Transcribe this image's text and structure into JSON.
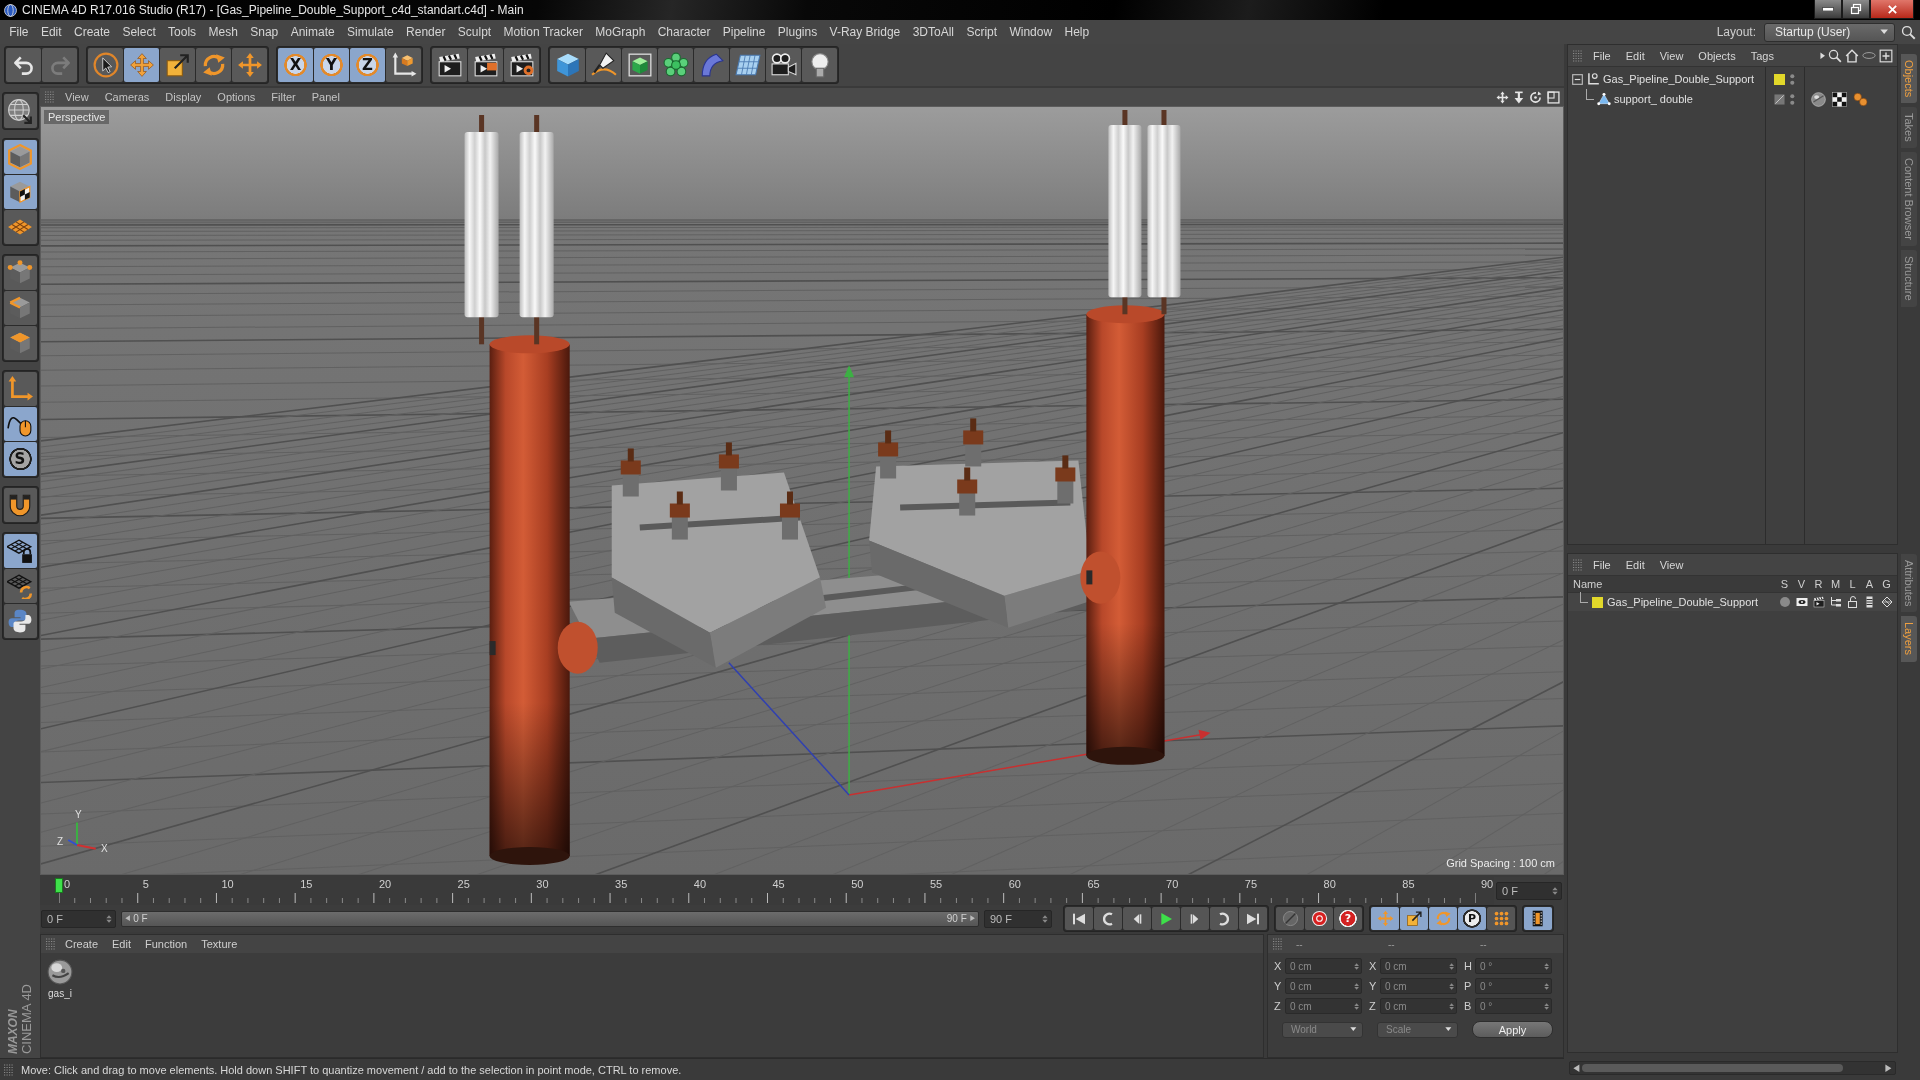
{
  "title_bar": {
    "title": "CINEMA 4D R17.016 Studio (R17) - [Gas_Pipeline_Double_Support_c4d_standart.c4d] - Main"
  },
  "menu_bar": {
    "items": [
      "File",
      "Edit",
      "Create",
      "Select",
      "Tools",
      "Mesh",
      "Snap",
      "Animate",
      "Simulate",
      "Render",
      "Sculpt",
      "Motion Tracker",
      "MoGraph",
      "Character",
      "Pipeline",
      "Plugins",
      "V-Ray Bridge",
      "3DToAll",
      "Script",
      "Window",
      "Help"
    ],
    "layout_label": "Layout:",
    "layout_value": "Startup (User)"
  },
  "toolbar": {
    "groups": [
      [
        {
          "kind": "undo",
          "selected": false,
          "disabled": false
        },
        {
          "kind": "redo",
          "selected": false,
          "disabled": true
        }
      ],
      [
        {
          "kind": "select",
          "selected": false
        },
        {
          "kind": "move",
          "selected": true
        },
        {
          "kind": "scale",
          "selected": false
        },
        {
          "kind": "rotate",
          "selected": false
        },
        {
          "kind": "transform",
          "selected": false
        }
      ],
      [
        {
          "kind": "axis",
          "label": "X",
          "selected": true
        },
        {
          "kind": "axis",
          "label": "Y",
          "selected": true
        },
        {
          "kind": "axis",
          "label": "Z",
          "selected": true
        },
        {
          "kind": "coords",
          "selected": false
        }
      ],
      [
        {
          "kind": "render_view",
          "selected": false
        },
        {
          "kind": "render_pv",
          "selected": false
        },
        {
          "kind": "render_settings",
          "selected": false
        }
      ],
      [
        {
          "kind": "cube",
          "selected": false
        },
        {
          "kind": "pen",
          "selected": false
        },
        {
          "kind": "subdiv",
          "selected": false
        },
        {
          "kind": "cloner",
          "selected": false
        },
        {
          "kind": "deformer",
          "selected": false
        },
        {
          "kind": "floor",
          "selected": false
        },
        {
          "kind": "camera",
          "selected": false
        },
        {
          "kind": "light",
          "selected": false
        }
      ]
    ]
  },
  "left_toolbar": {
    "groups": [
      [
        {
          "kind": "make_editable",
          "selected": false
        }
      ],
      [
        {
          "kind": "model",
          "selected": true
        },
        {
          "kind": "texture",
          "selected": true
        },
        {
          "kind": "workplane",
          "selected": false
        }
      ],
      [
        {
          "kind": "points",
          "selected": false
        },
        {
          "kind": "edges",
          "selected": false
        },
        {
          "kind": "polygons",
          "selected": false
        }
      ],
      [
        {
          "kind": "axis_mode",
          "selected": false
        },
        {
          "kind": "tweak",
          "selected": true
        },
        {
          "kind": "snap",
          "label": "S",
          "selected": true
        }
      ],
      [
        {
          "kind": "magnet",
          "selected": false
        }
      ],
      [
        {
          "kind": "lock_grid",
          "selected": true
        },
        {
          "kind": "grid_rotate",
          "selected": false
        },
        {
          "kind": "python",
          "selected": false
        }
      ]
    ],
    "logo": {
      "brand": "MAXON",
      "product": "CINEMA 4D"
    }
  },
  "viewport": {
    "menu": [
      "View",
      "Cameras",
      "Display",
      "Options",
      "Filter",
      "Panel"
    ],
    "camera": "Perspective",
    "grid_spacing": "Grid Spacing : 100 cm",
    "gizmo": {
      "y": "Y",
      "z": "Z",
      "x": "X"
    }
  },
  "timeline": {
    "ticks": [
      "0",
      "5",
      "10",
      "15",
      "20",
      "25",
      "30",
      "35",
      "40",
      "45",
      "50",
      "55",
      "60",
      "65",
      "70",
      "75",
      "80",
      "85",
      "90"
    ],
    "playhead": {
      "level": 0
    },
    "frame_field": "0 F",
    "start_field": "0 F",
    "range_start": "0 F",
    "range_end": "90 F",
    "end_field": "90 F",
    "playback": [
      {
        "kind": "goto_start"
      },
      {
        "kind": "prev_key"
      },
      {
        "kind": "prev_frame"
      },
      {
        "kind": "play"
      },
      {
        "kind": "next_frame"
      },
      {
        "kind": "next_key"
      },
      {
        "kind": "goto_end"
      }
    ],
    "key_groups": [
      [
        {
          "kind": "record_off",
          "selected": false
        },
        {
          "kind": "record",
          "selected": false
        },
        {
          "kind": "keysel",
          "label": "?",
          "selected": false
        }
      ],
      [
        {
          "kind": "key_move",
          "selected": true
        },
        {
          "kind": "key_scale",
          "selected": true
        },
        {
          "kind": "key_rotate",
          "selected": true
        },
        {
          "kind": "param",
          "label": "P",
          "selected": true
        },
        {
          "kind": "key_pla",
          "selected": false
        }
      ],
      [
        {
          "kind": "timeline",
          "selected": true
        }
      ]
    ]
  },
  "material_manager": {
    "menu": [
      "Create",
      "Edit",
      "Function",
      "Texture"
    ],
    "materials": [
      {
        "name": "gas_i"
      }
    ]
  },
  "coordinates": {
    "headers": [
      "--",
      "--",
      "--"
    ],
    "rows": [
      [
        {
          "axis": "X",
          "value": "0 cm"
        },
        {
          "axis": "X",
          "value": "0 cm"
        },
        {
          "axis": "H",
          "value": "0 °"
        }
      ],
      [
        {
          "axis": "Y",
          "value": "0 cm"
        },
        {
          "axis": "Y",
          "value": "0 cm"
        },
        {
          "axis": "P",
          "value": "0 °"
        }
      ],
      [
        {
          "axis": "Z",
          "value": "0 cm"
        },
        {
          "axis": "Z",
          "value": "0 cm"
        },
        {
          "axis": "B",
          "value": "0 °"
        }
      ]
    ],
    "mode": "World",
    "size_mode": "Scale",
    "apply": "Apply"
  },
  "status_bar": {
    "text": "Move: Click and drag to move elements. Hold down SHIFT to quantize movement / add to the selection in point mode, CTRL to remove."
  },
  "object_manager": {
    "menu": [
      "File",
      "Edit",
      "View",
      "Objects",
      "Tags"
    ],
    "objects": [
      {
        "name": "Gas_Pipeline_Double_Support",
        "kind": "null",
        "expanded": true,
        "color": "#e2d82a",
        "children": [
          {
            "name": "support_ double",
            "kind": "polygon",
            "tags": [
              {
                "kind": "phong"
              },
              {
                "kind": "material"
              },
              {
                "kind": "texture"
              }
            ]
          }
        ]
      }
    ]
  },
  "layer_manager": {
    "menu": [
      "File",
      "Edit",
      "View"
    ],
    "columns": [
      "Name",
      "S",
      "V",
      "R",
      "M",
      "L",
      "A",
      "G"
    ],
    "layers": [
      {
        "name": "Gas_Pipeline_Double_Support",
        "color": "#e2d82a"
      }
    ]
  },
  "side_tabs": {
    "top": [
      {
        "label": "Objects",
        "selected": true
      },
      {
        "label": "Takes",
        "selected": false
      },
      {
        "label": "Content Browser",
        "selected": false
      },
      {
        "label": "Structure",
        "selected": false
      }
    ],
    "bottom": [
      {
        "label": "Attributes",
        "selected": false
      },
      {
        "label": "Layers",
        "selected": true
      }
    ]
  }
}
